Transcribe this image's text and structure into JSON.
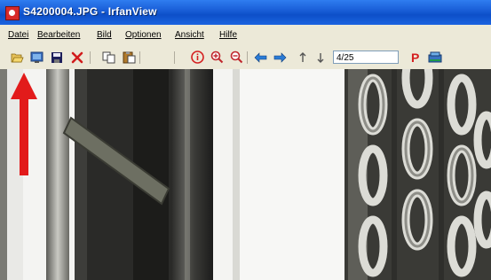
{
  "window": {
    "title": "S4200004.JPG - IrfanView"
  },
  "menu": {
    "items": [
      {
        "label": "Datei"
      },
      {
        "label": "Bearbeiten"
      },
      {
        "label": "Bild"
      },
      {
        "label": "Optionen"
      },
      {
        "label": "Ansicht"
      },
      {
        "label": "Hilfe"
      }
    ]
  },
  "toolbar": {
    "page_counter": "4/25",
    "icons": [
      "open-folder-icon",
      "slideshow-icon",
      "save-icon",
      "delete-icon",
      "copy-icon",
      "paste-icon",
      "info-icon",
      "zoom-in-icon",
      "zoom-out-icon",
      "previous-icon",
      "next-icon",
      "first-icon",
      "last-icon",
      "print-icon",
      "scan-icon"
    ]
  },
  "colors": {
    "titlebar": "#1a5fd8",
    "menubar": "#ece9d8",
    "annotation_arrow": "#e21b1b"
  }
}
